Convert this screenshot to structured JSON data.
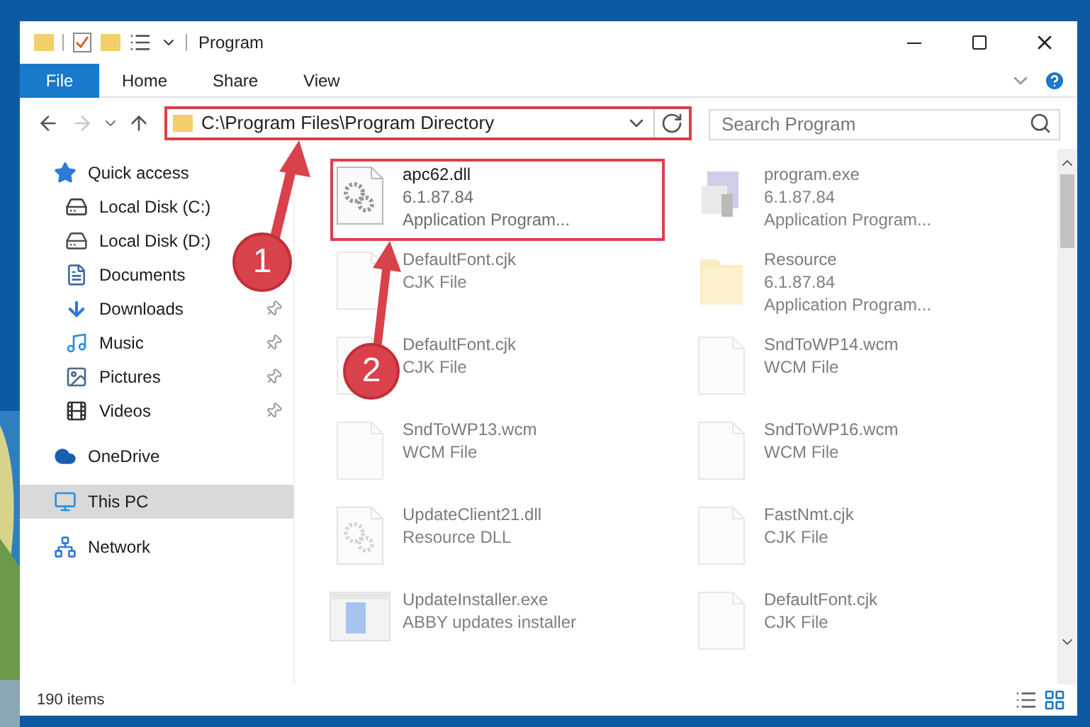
{
  "window": {
    "title": "Program"
  },
  "ribbon_tabs": [
    {
      "label": "File",
      "selected": true
    },
    {
      "label": "Home",
      "selected": false
    },
    {
      "label": "Share",
      "selected": false
    },
    {
      "label": "View",
      "selected": false
    }
  ],
  "address_bar": {
    "value": "C:\\Program Files\\Program Directory"
  },
  "search": {
    "placeholder": "Search Program"
  },
  "sidebar": {
    "items": [
      {
        "label": "Quick access",
        "kind": "star",
        "selected": false,
        "children": [
          {
            "label": "Local Disk (C:)",
            "kind": "drive-c",
            "pinned": false
          },
          {
            "label": "Local Disk (D:)",
            "kind": "drive",
            "pinned": false
          },
          {
            "label": "Documents",
            "kind": "documents",
            "pinned": false
          },
          {
            "label": "Downloads",
            "kind": "downloads",
            "pinned": true
          },
          {
            "label": "Music",
            "kind": "music",
            "pinned": true
          },
          {
            "label": "Pictures",
            "kind": "pictures",
            "pinned": true
          },
          {
            "label": "Videos",
            "kind": "videos",
            "pinned": true
          }
        ]
      },
      {
        "label": "OneDrive",
        "kind": "cloud",
        "selected": false
      },
      {
        "label": "This PC",
        "kind": "pc",
        "selected": true
      },
      {
        "label": "Network",
        "kind": "network",
        "selected": false
      }
    ]
  },
  "files": [
    {
      "name": "apc62.dll",
      "lines": [
        "6.1.87.84",
        "Application Program..."
      ],
      "kind": "dll",
      "dimmed": false
    },
    {
      "name": "program.exe",
      "lines": [
        "6.1.87.84",
        "Application Program..."
      ],
      "kind": "exe",
      "dimmed": true
    },
    {
      "name": "DefaultFont.cjk",
      "lines": [
        "CJK File"
      ],
      "kind": "file",
      "dimmed": true
    },
    {
      "name": "Resource",
      "lines": [
        "6.1.87.84",
        "Application Program..."
      ],
      "kind": "folder",
      "dimmed": true
    },
    {
      "name": "DefaultFont.cjk",
      "lines": [
        "CJK File"
      ],
      "kind": "file",
      "dimmed": true
    },
    {
      "name": "SndToWP14.wcm",
      "lines": [
        "WCM File"
      ],
      "kind": "file",
      "dimmed": true
    },
    {
      "name": "SndToWP13.wcm",
      "lines": [
        "WCM File"
      ],
      "kind": "file",
      "dimmed": true
    },
    {
      "name": "SndToWP16.wcm",
      "lines": [
        "WCM File"
      ],
      "kind": "file",
      "dimmed": true
    },
    {
      "name": "UpdateClient21.dll",
      "lines": [
        "Resource DLL"
      ],
      "kind": "dll",
      "dimmed": true
    },
    {
      "name": "FastNmt.cjk",
      "lines": [
        "CJK File"
      ],
      "kind": "file",
      "dimmed": true
    },
    {
      "name": "UpdateInstaller.exe",
      "lines": [
        "ABBY updates installer"
      ],
      "kind": "installer",
      "dimmed": true
    },
    {
      "name": "DefaultFont.cjk",
      "lines": [
        "CJK File"
      ],
      "kind": "file",
      "dimmed": true
    }
  ],
  "status_bar": {
    "item_count": "190 items"
  },
  "annotations": [
    {
      "label": "1"
    },
    {
      "label": "2"
    }
  ]
}
